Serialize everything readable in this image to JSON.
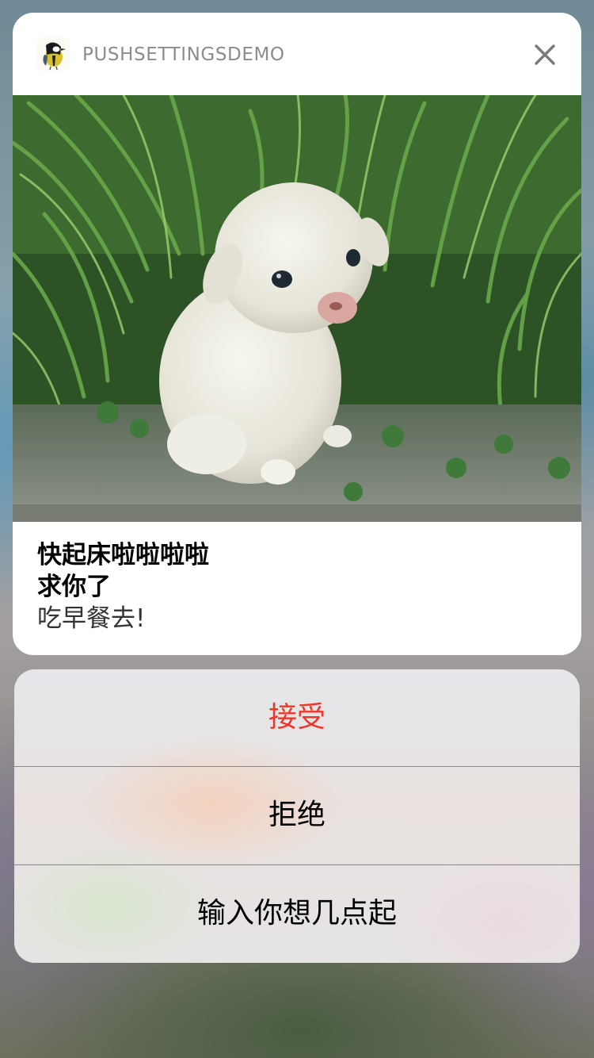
{
  "notification": {
    "app_name": "PUSHSETTINGSDEMO",
    "app_icon": "bird-icon",
    "close_icon": "close-icon",
    "attachment_image": "puppy-photo",
    "title": "快起床啦啦啦啦",
    "subtitle": "求你了",
    "message": "吃早餐去!"
  },
  "actions": [
    {
      "label": "接受",
      "color": "#f2352a",
      "style": "destructive"
    },
    {
      "label": "拒绝",
      "color": "#000000"
    },
    {
      "label": "输入你想几点起",
      "color": "#000000"
    }
  ]
}
